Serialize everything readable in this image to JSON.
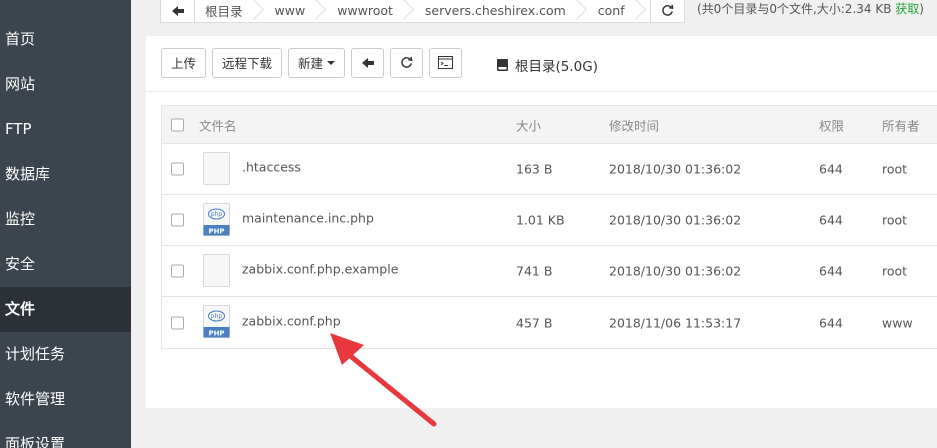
{
  "sidebar": {
    "items": [
      {
        "label": "首页"
      },
      {
        "label": "网站"
      },
      {
        "label": "FTP"
      },
      {
        "label": "数据库"
      },
      {
        "label": "监控"
      },
      {
        "label": "安全"
      },
      {
        "label": "文件",
        "active": true
      },
      {
        "label": "计划任务"
      },
      {
        "label": "软件管理"
      },
      {
        "label": "面板设置"
      }
    ]
  },
  "breadcrumb": {
    "items": [
      "根目录",
      "www",
      "wwwroot",
      "servers.cheshirex.com",
      "conf"
    ],
    "info_prefix": "(共0个目录与0个文件,大小:2.34 KB",
    "info_link": "获取",
    "info_suffix": ")"
  },
  "toolbar": {
    "upload": "上传",
    "remote_download": "远程下载",
    "new": "新建",
    "disk_label": "根目录(5.0G)"
  },
  "table": {
    "headers": {
      "name": "文件名",
      "size": "大小",
      "mtime": "修改时间",
      "perm": "权限",
      "owner": "所有者"
    },
    "rows": [
      {
        "name": ".htaccess",
        "size": "163 B",
        "mtime": "2018/10/30 01:36:02",
        "perm": "644",
        "owner": "root",
        "icon": "generic-file-icon"
      },
      {
        "name": "maintenance.inc.php",
        "size": "1.01 KB",
        "mtime": "2018/10/30 01:36:02",
        "perm": "644",
        "owner": "root",
        "icon": "php-file-icon"
      },
      {
        "name": "zabbix.conf.php.example",
        "size": "741 B",
        "mtime": "2018/10/30 01:36:02",
        "perm": "644",
        "owner": "root",
        "icon": "generic-file-icon"
      },
      {
        "name": "zabbix.conf.php",
        "size": "457 B",
        "mtime": "2018/11/06 11:53:17",
        "perm": "644",
        "owner": "www",
        "icon": "php-file-icon"
      }
    ]
  },
  "colors": {
    "sidebar_bg": "#3c444d",
    "sidebar_active": "#2c3138",
    "link_green": "#20a53a",
    "annotation_arrow": "#e8383d",
    "php_icon_blue": "#4a7fc1"
  }
}
